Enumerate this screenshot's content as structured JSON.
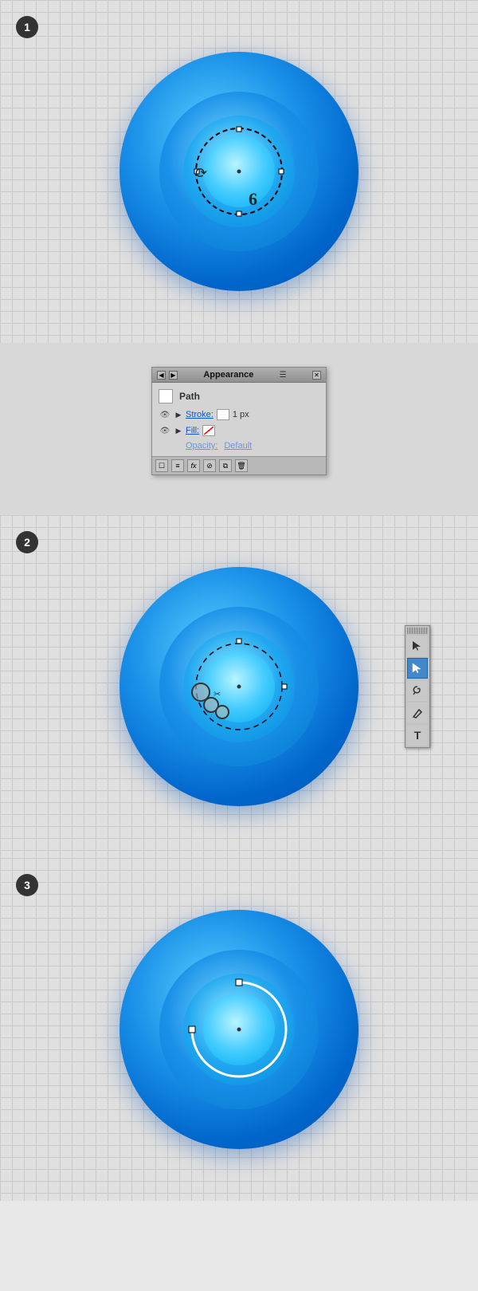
{
  "steps": [
    {
      "number": "1",
      "description": "Circle with dashed selection and anchor points"
    },
    {
      "number": "2",
      "description": "Scissors tool cutting path"
    },
    {
      "number": "3",
      "description": "Resulting arc path"
    }
  ],
  "appearance_panel": {
    "title": "Appearance",
    "object_type": "Path",
    "stroke_label": "Stroke:",
    "stroke_value": "1 px",
    "fill_label": "Fill:",
    "opacity_label": "Opacity:",
    "opacity_value": "Default",
    "buttons": {
      "add_new": "Add New",
      "clear_appearance": "Clear Appearance",
      "reduce": "Reduce",
      "duplicate": "Duplicate",
      "delete": "Delete"
    }
  },
  "tools": [
    {
      "name": "selection",
      "icon": "↖",
      "active": false
    },
    {
      "name": "direct-selection",
      "icon": "↗",
      "active": true
    },
    {
      "name": "lasso",
      "icon": "⤵",
      "active": false
    },
    {
      "name": "pen",
      "icon": "✒",
      "active": false
    },
    {
      "name": "text",
      "icon": "T",
      "active": false
    }
  ]
}
